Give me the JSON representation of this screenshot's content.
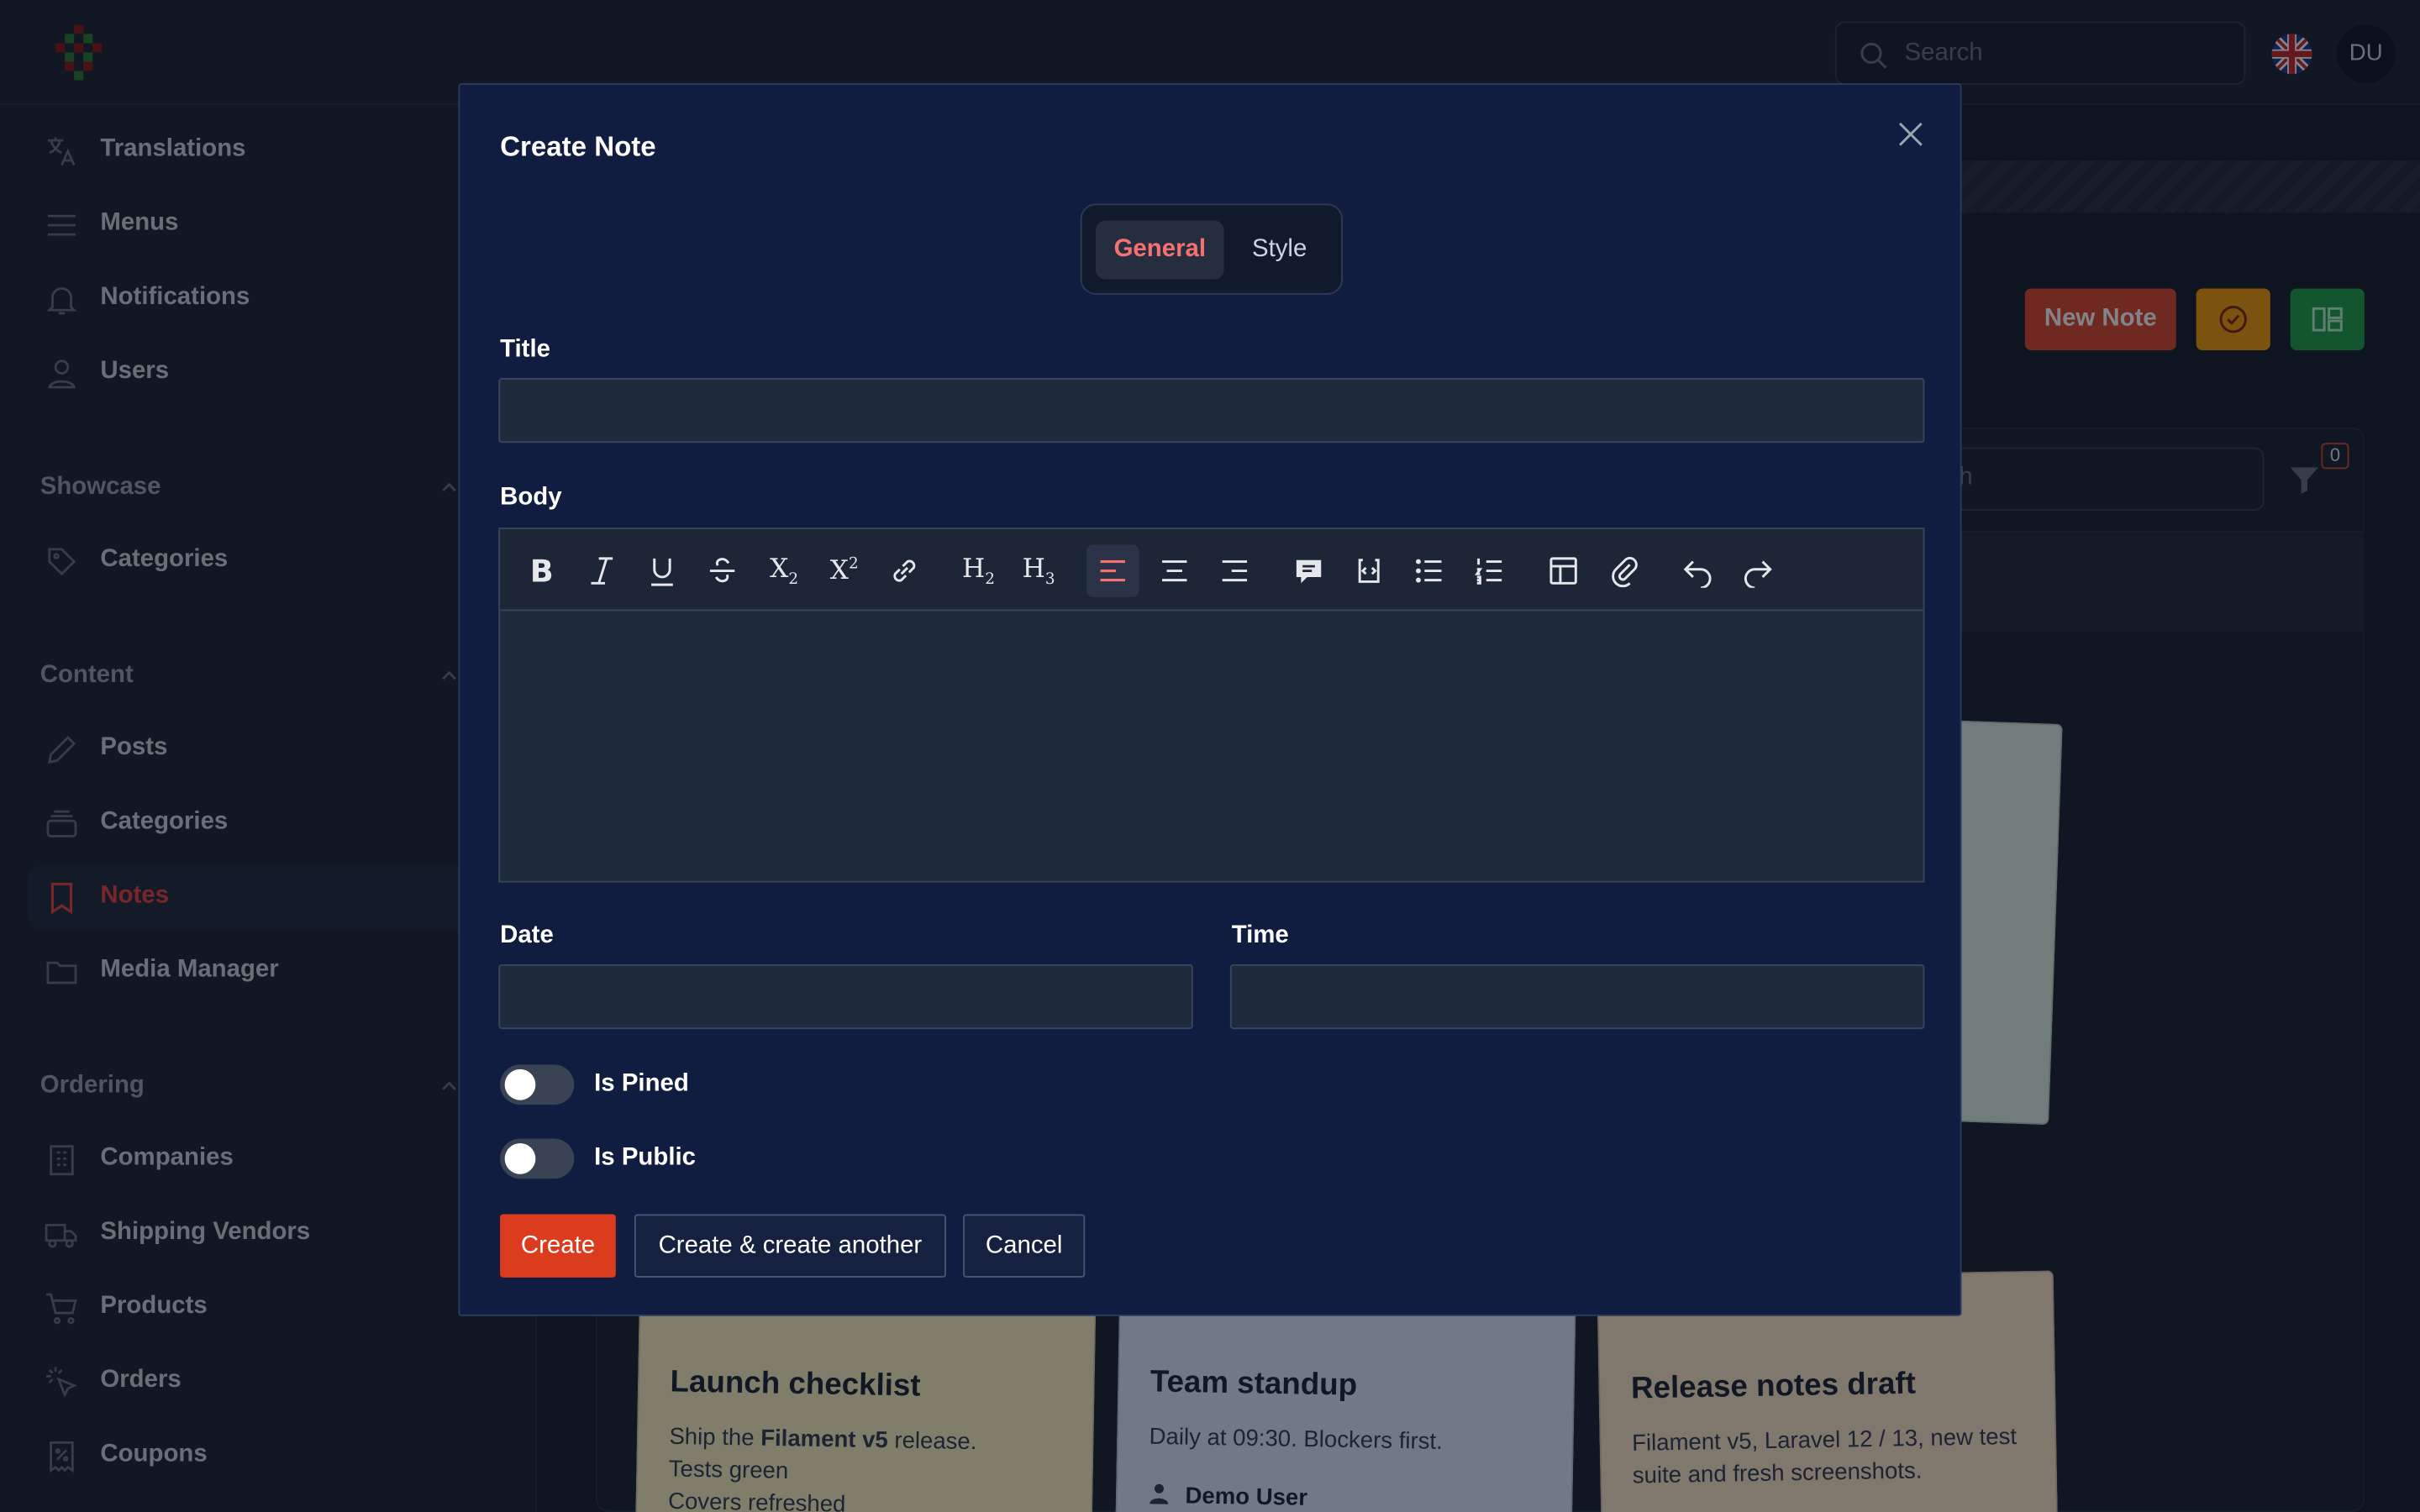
{
  "header": {
    "search_placeholder": "Search",
    "avatar_initials": "DU"
  },
  "sidebar": {
    "items_top": [
      {
        "label": "Translations",
        "icon": "translate-icon"
      },
      {
        "label": "Menus",
        "icon": "menu-icon"
      },
      {
        "label": "Notifications",
        "icon": "bell-icon"
      },
      {
        "label": "Users",
        "icon": "user-icon"
      }
    ],
    "groups": [
      {
        "label": "Showcase",
        "items": [
          {
            "label": "Categories",
            "icon": "tags-icon"
          }
        ]
      },
      {
        "label": "Content",
        "items": [
          {
            "label": "Posts",
            "icon": "pencil-icon"
          },
          {
            "label": "Categories",
            "icon": "stack-icon"
          },
          {
            "label": "Notes",
            "icon": "bookmark-icon",
            "active": true
          },
          {
            "label": "Media Manager",
            "icon": "folder-icon"
          }
        ]
      },
      {
        "label": "Ordering",
        "items": [
          {
            "label": "Companies",
            "icon": "building-icon"
          },
          {
            "label": "Shipping Vendors",
            "icon": "truck-icon"
          },
          {
            "label": "Products",
            "icon": "cart-icon"
          },
          {
            "label": "Orders",
            "icon": "cursor-click-icon"
          },
          {
            "label": "Coupons",
            "icon": "receipt-icon"
          }
        ]
      }
    ]
  },
  "page": {
    "new_note_label": "New Note",
    "table_search_placeholder": "rch",
    "filter_count": "0"
  },
  "cards": [
    {
      "title": "Launch checklist",
      "body_prefix": "Ship the ",
      "body_bold": "Filament v5",
      "body_suffix": " release.",
      "line2": "Tests green",
      "line3": "Covers refreshed"
    },
    {
      "title": "Team standup",
      "body": "Daily at 09:30. Blockers first.",
      "author": "Demo User"
    },
    {
      "title": "Release notes draft",
      "body": "Filament v5, Laravel 12 / 13, new test suite and fresh screenshots."
    }
  ],
  "modal": {
    "title": "Create Note",
    "tabs": [
      {
        "label": "General",
        "active": true
      },
      {
        "label": "Style",
        "active": false
      }
    ],
    "fields": {
      "title_label": "Title",
      "title_value": "",
      "body_label": "Body",
      "date_label": "Date",
      "date_value": "",
      "time_label": "Time",
      "time_value": ""
    },
    "toolbar": [
      "bold",
      "italic",
      "underline",
      "strike",
      "subscript",
      "superscript",
      "link",
      "h2",
      "h3",
      "align-left",
      "align-center",
      "align-right",
      "blockquote",
      "code-block",
      "bullet-list",
      "ordered-list",
      "table",
      "attach",
      "undo",
      "redo"
    ],
    "toolbar_active": "align-left",
    "toggles": [
      {
        "label": "Is Pined",
        "on": false
      },
      {
        "label": "Is Public",
        "on": false
      }
    ],
    "buttons": {
      "create": "Create",
      "create_another": "Create & create another",
      "cancel": "Cancel"
    },
    "accent_color": "#dc3c1e"
  }
}
